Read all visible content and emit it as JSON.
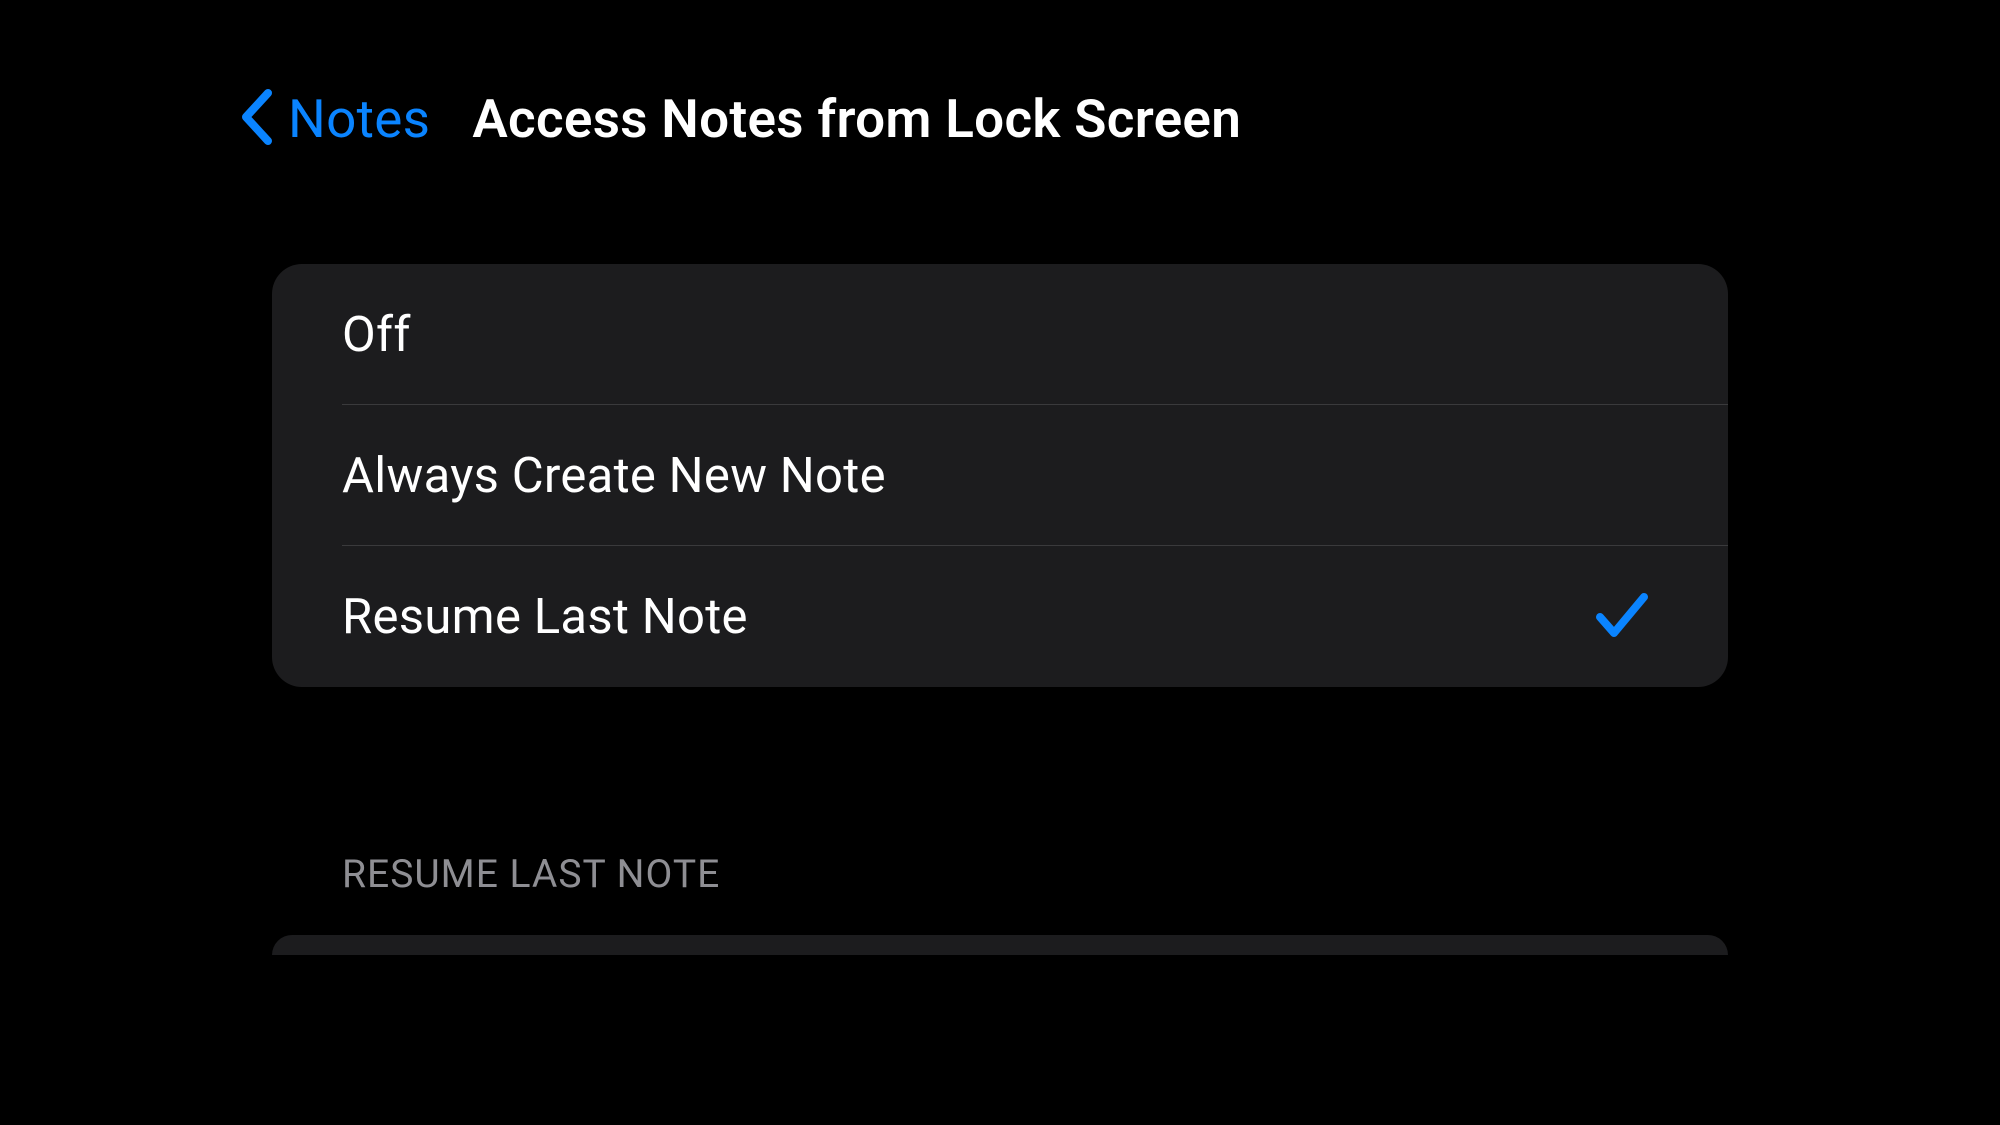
{
  "colors": {
    "accent": "#0a84ff",
    "background": "#000000",
    "card": "#1c1c1e",
    "text": "#ffffff",
    "secondary": "#8e8e93",
    "divider": "#3a3a3c"
  },
  "header": {
    "back_label": "Notes",
    "title": "Access Notes from Lock Screen"
  },
  "options": [
    {
      "label": "Off",
      "selected": false
    },
    {
      "label": "Always Create New Note",
      "selected": false
    },
    {
      "label": "Resume Last Note",
      "selected": true
    }
  ],
  "section_header": "RESUME LAST NOTE"
}
